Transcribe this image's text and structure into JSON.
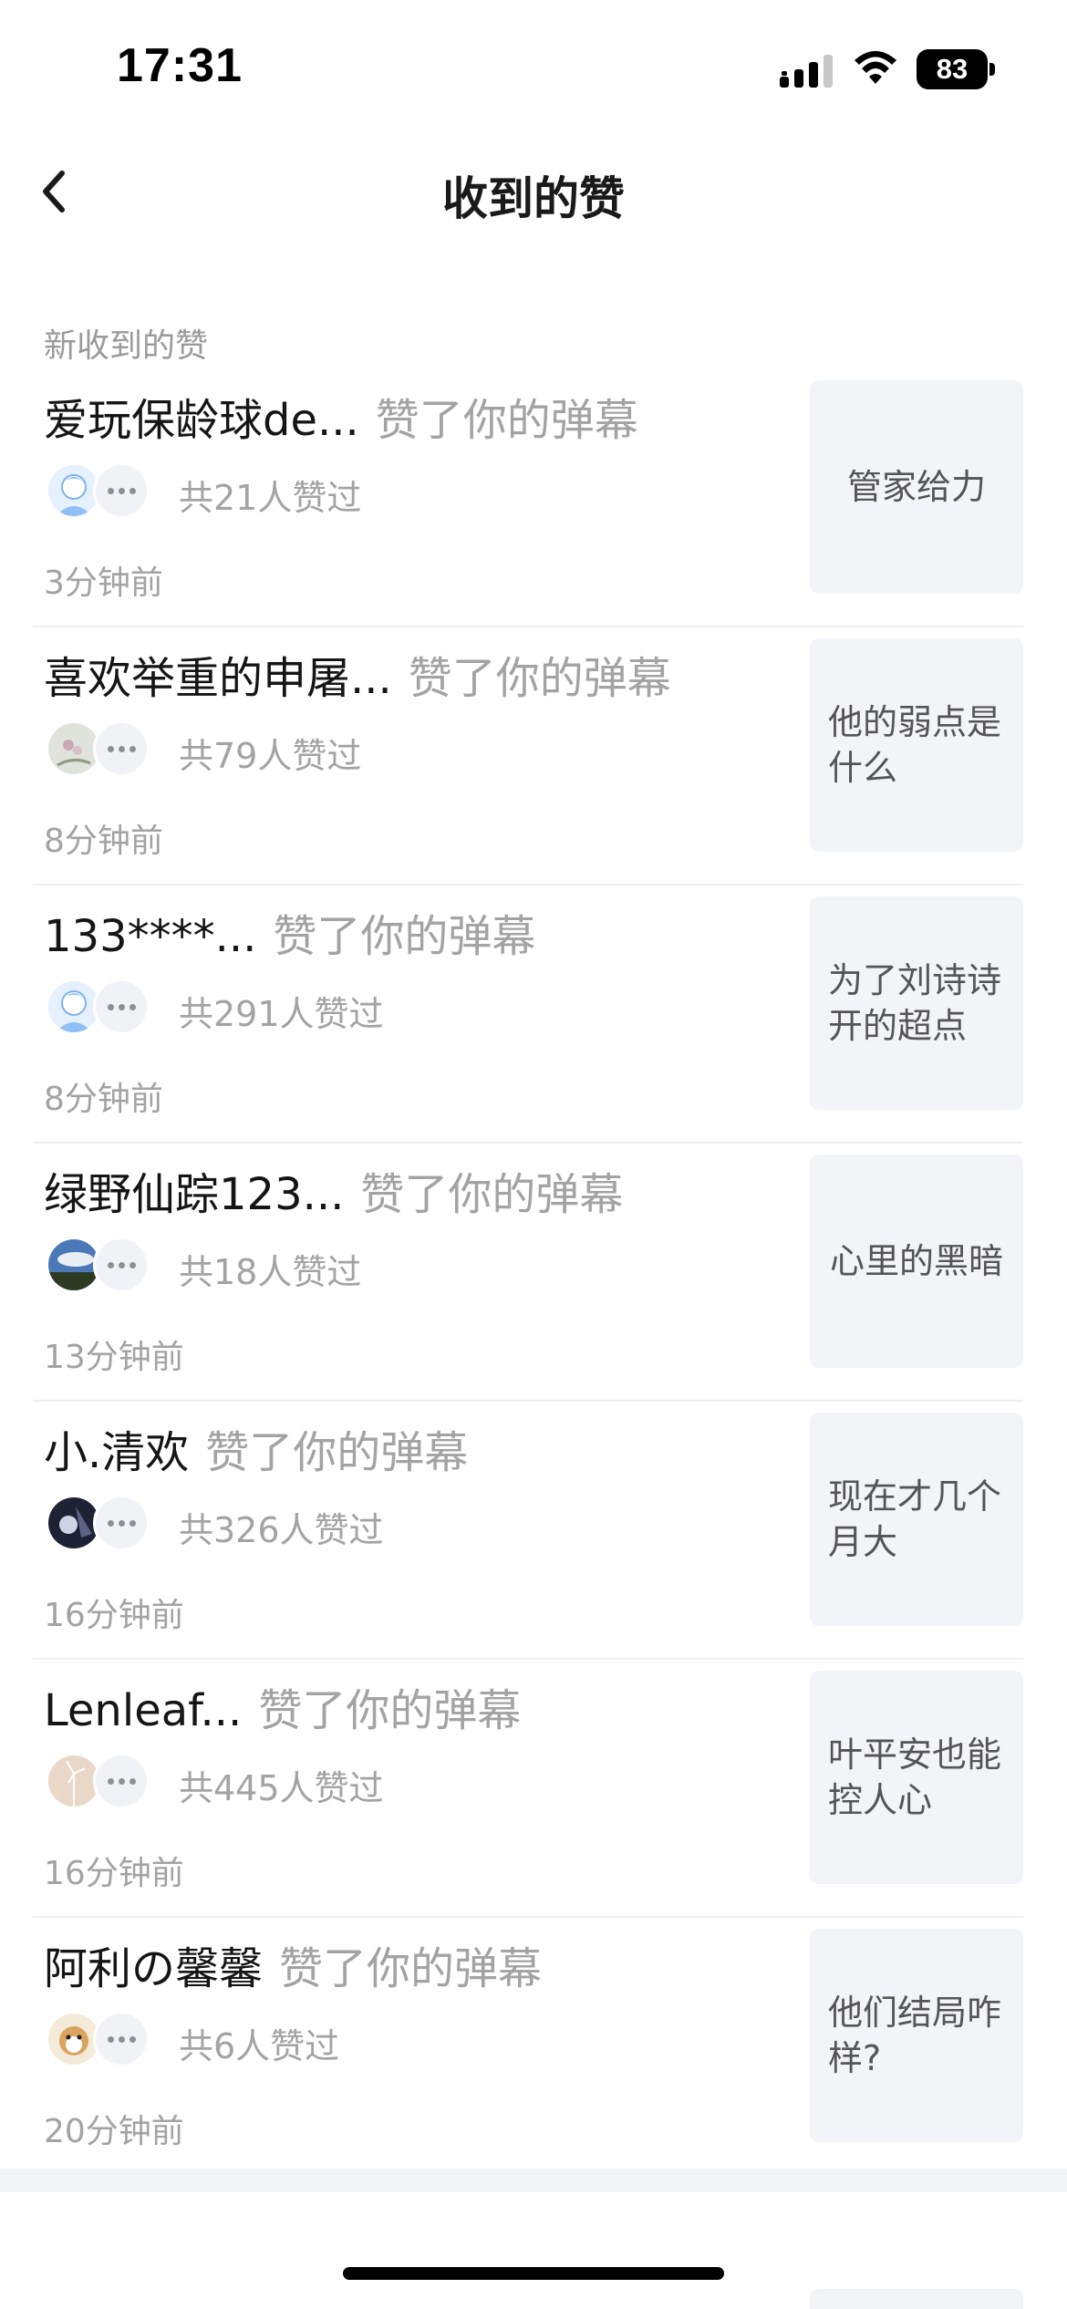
{
  "status_bar": {
    "time": "17:31",
    "battery": "83"
  },
  "nav": {
    "title": "收到的赞"
  },
  "section": {
    "label": "新收到的赞"
  },
  "items": [
    {
      "username": "爱玩保龄球de...",
      "action": "赞了你的弹幕",
      "count": "共21人赞过",
      "time": "3分钟前",
      "quote": "管家给力",
      "avatar": "avatar-cartoon-boy"
    },
    {
      "username": "喜欢举重的申屠...",
      "action": "赞了你的弹幕",
      "count": "共79人赞过",
      "time": "8分钟前",
      "quote": "他的弱点是什么",
      "avatar": "avatar-flower"
    },
    {
      "username": "133****...",
      "action": "赞了你的弹幕",
      "count": "共291人赞过",
      "time": "8分钟前",
      "quote": "为了刘诗诗开的超点",
      "avatar": "avatar-cartoon-boy"
    },
    {
      "username": "绿野仙踪123...",
      "action": "赞了你的弹幕",
      "count": "共18人赞过",
      "time": "13分钟前",
      "quote": "心里的黑暗",
      "avatar": "avatar-landscape"
    },
    {
      "username": "小.清欢",
      "action": "赞了你的弹幕",
      "count": "共326人赞过",
      "time": "16分钟前",
      "quote": "现在才几个月大",
      "avatar": "avatar-dark-figure"
    },
    {
      "username": "Lenleaf...",
      "action": "赞了你的弹幕",
      "count": "共445人赞过",
      "time": "16分钟前",
      "quote": "叶平安也能控人心",
      "avatar": "avatar-windmill"
    },
    {
      "username": "阿利の馨馨",
      "action": "赞了你的弹幕",
      "count": "共6人赞过",
      "time": "20分钟前",
      "quote": "他们结局咋样?",
      "avatar": "avatar-dog"
    }
  ]
}
